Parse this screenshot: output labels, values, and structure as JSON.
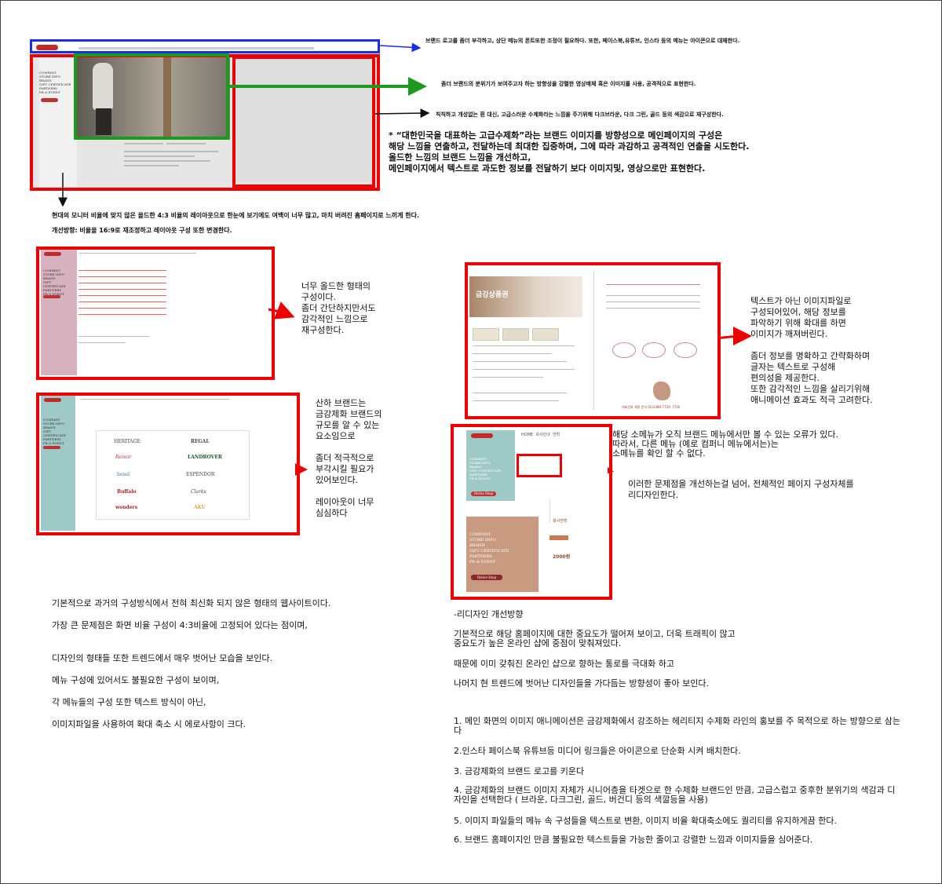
{
  "notes": {
    "top_blue": "브랜드 로고를 좀더 부각하고, 상단 메뉴의 폰트또한 조정이 필요하다.  또한, 페이스북,유튜브, 인스타 등의 메뉴는 아이콘으로 대체한다.",
    "top_green": "좀더 브랜드의 분위기가 보여주고자 하는 방향성을 강렬한 영상매체 혹은 이미지를 사용, 공격적으로 표현한다.",
    "top_black": "칙칙하고 개성없는 흰 대신, 고급스러운 수제화라는 느낌을 주기위해 다크브라운, 다크 그린, 골드 등의 색감으로 재구성한다.",
    "main_direction": [
      "* “대한민국을 대표하는 고급수제화”라는 브랜드 이미지를 방향성으로 메인페이지의 구성은",
      "해당 느낌을 연출하고, 전달하는데 최대한 집중하며, 그에 따라 과감하고 공격적인 연출을 시도한다.",
      "올드한 느낌의 브랜드 느낌을 개선하고,",
      "메인페이지에서 텍스트로 과도한 정보를 전달하기 보다 이미지및, 영상으로만 표현한다."
    ],
    "layout_issue": "현대의 모니터 비율에 맞지 않은 올드한 4:3 비율의 레이아웃으로 한눈에 보기에도 여백이 너무 많고, 마치 버려진 홈페이지로 느끼게 한다.",
    "layout_fix": "개선방향: 비율을 16:9로 재조정하고 레이아웃 구성 또한 변경한다.",
    "sub1": [
      "너무 올드한 형태의",
      "구성이다.",
      "좀더 간단하지만서도",
      "감각적인 느낌으로",
      "재구성한다."
    ],
    "sub2": [
      "산하 브랜드는",
      "금강제화 브랜드의",
      "규모를 알 수 있는",
      "요소임으로",
      "",
      "좀더 적극적으로",
      "부각시킬 필요가",
      "있어보인다.",
      "",
      "레이아웃이 너무",
      "심심하다"
    ],
    "sub3": [
      "텍스트가 아닌 이미지파일로",
      "구성되어있어, 해당 정보를",
      "파악하기 위해 확대를 하면",
      "이미지가 깨져버린다.",
      "",
      "좀더 정보를 명확하고 간략화하며",
      "글자는 텍스트로 구성해",
      "편의성을 제공한다.",
      "또한 감각적인 느낌을 살리기위해",
      "애니메이션 효과도 적극 고려한다."
    ],
    "sub4_a": [
      "해당 소메뉴가 오직 브랜드 메뉴에서만 볼 수 있는 오류가 있다.",
      "따라서, 다른 메뉴 (예로 컴퍼니 메뉴에서는)는",
      "소메뉴를 확인 할 수 없다."
    ],
    "sub4_b": [
      "이러한 문제점을 개선하는걸 넘어, 전체적인 페이지 구성자체를",
      "리디자인한다."
    ]
  },
  "bottom_left": [
    "기본적으로 과거의 구성방식에서 전혀 최신화 되지 않은 형태의 웹사이트이다.",
    "가장 큰 문제점은 화면 비율 구성이 4:3비율에 고정되어 있다는 점이며,",
    "디자인의 형태들 또한 트렌드에서 매우 벗어난 모습을 보인다.",
    "메뉴 구성에 있어서도 불필요한 구성이 보이며,",
    "각 메뉴들의 구성 또한 텍스트 방식이 아닌,",
    "이미지파일을 사용하여 확대 축소 시 에로사항이 크다."
  ],
  "bottom_right": {
    "heading": "-리디자인 개선방향",
    "intro": [
      "기본적으로 해당 홈페이지에 대한 중요도가 떨어져 보이고, 더욱 트래픽이 많고",
      "중요도가 높은 온라인 샵에 중점이 맞춰져있다.",
      "때문에 이미 갖춰진 온라인 샵으로 향하는 통로를 극대화 하고",
      "나머지 현 트렌드에 벗어난 디자인들을 가다듬는 방향성이 좋아 보인다."
    ],
    "items": [
      "1. 메인 화면의 이미지 애니메이션은 금강제화에서 강조하는 헤리티지 수제화 라인의 홍보를 주 목적으로 하는 방향으로 삼는다",
      "2.인스타 페이스북 유튜브등 미디어 링크들은 아이콘으로 단순화 시켜 배치한다.",
      "3. 금강제화의 브랜드 로고를 키운다",
      "4. 금강제화의 브랜드 이미지 자체가 시니어층을 타겟으로 한 수제화 브랜드인 만큼, 고급스럽고 중후한 분위기의 색감과 디자인을 선택한다 ( 브라운, 다크그린, 골드, 버건디 등의 색깔등을 사용)",
      "5. 이미지 파일들의 메뉴 속 구성들을 텍스트로 변환, 이미지 비율 확대축소에도 퀄리티를 유지하게끔 한다.",
      "6. 브랜드 홈페이지인 만큼 불필요한 텍스트들을 가능한 줄이고 강렬한 느낌과 이미지들을 심어준다."
    ]
  },
  "screens": {
    "menu": [
      "COMPANY",
      "STORE INFO",
      "BRAND",
      "GIFT CERTIFICATE",
      "PARTNERS",
      "PR & EVENT"
    ],
    "online_shop": "Online Shop",
    "brands": [
      "HERITAGE",
      "REGAL",
      "Renoir",
      "LANDROVER",
      "bosel",
      "ESPÉNDOR",
      "Buffalo",
      "Clarks",
      "wonders",
      "AKU"
    ],
    "gift_title": "금강상품권",
    "gift_phone": "대표전화 계정 문의 02)3489-7729, 7726",
    "detail_price": "2000원",
    "detail_title": "회사연혁",
    "submenu_tabs": [
      "HOME",
      "회사안내",
      "연혁"
    ],
    "detail_nav": [
      "COMPANY",
      "STORE INFO",
      "BRAND",
      "GIFT CERTIFICATE",
      "PARTNERS",
      "PR & EVENT"
    ],
    "online_shop_btn": "Online Shop"
  },
  "colors": {
    "red": "#e00000",
    "blue": "#1a2ee6",
    "green": "#1d9a1d",
    "teal": "#9fc9c7",
    "pink": "#d8b1bf",
    "brown": "#c99a7f"
  }
}
